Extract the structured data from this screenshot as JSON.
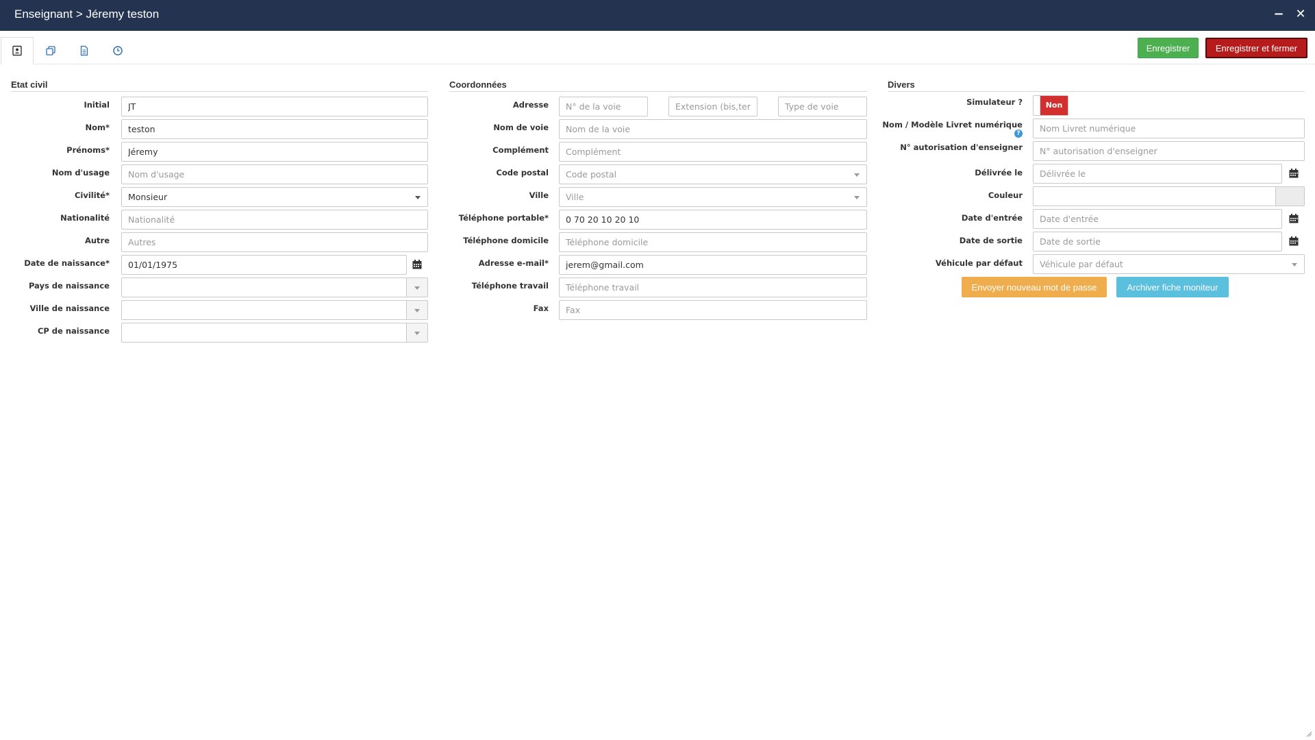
{
  "window": {
    "title": "Enseignant > Jéremy teston",
    "minimize_glyph": "−",
    "close_glyph": "✕"
  },
  "tabs": [
    {
      "icon": "contact-card-icon"
    },
    {
      "icon": "copy-icon"
    },
    {
      "icon": "document-icon"
    },
    {
      "icon": "clock-icon"
    }
  ],
  "toolbar": {
    "save_label": "Enregistrer",
    "save_close_label": "Enregistrer et fermer"
  },
  "etat_civil": {
    "title": "Etat civil",
    "initial": {
      "label": "Initial",
      "value": "JT",
      "placeholder": ""
    },
    "nom": {
      "label": "Nom*",
      "value": "teston",
      "placeholder": ""
    },
    "prenoms": {
      "label": "Prénoms*",
      "value": "Jéremy",
      "placeholder": ""
    },
    "nom_usage": {
      "label": "Nom d'usage",
      "value": "",
      "placeholder": "Nom d'usage"
    },
    "civilite": {
      "label": "Civilité*",
      "value": "Monsieur"
    },
    "nationalite": {
      "label": "Nationalité",
      "value": "",
      "placeholder": "Nationalité"
    },
    "autre": {
      "label": "Autre",
      "value": "",
      "placeholder": "Autres"
    },
    "date_naissance": {
      "label": "Date de naissance*",
      "value": "01/01/1975",
      "placeholder": ""
    },
    "pays_naissance": {
      "label": "Pays de naissance"
    },
    "ville_naissance": {
      "label": "Ville de naissance"
    },
    "cp_naissance": {
      "label": "CP de naissance"
    }
  },
  "coordonnees": {
    "title": "Coordonnées",
    "adresse": {
      "label": "Adresse",
      "num_placeholder": "N° de la voie",
      "ext_placeholder": "Extension (bis,ter.",
      "type_placeholder": "Type de voie"
    },
    "nom_voie": {
      "label": "Nom de voie",
      "value": "",
      "placeholder": "Nom de la voie"
    },
    "complement": {
      "label": "Complément",
      "value": "",
      "placeholder": "Complément"
    },
    "code_postal": {
      "label": "Code postal",
      "value": "Code postal"
    },
    "ville": {
      "label": "Ville",
      "value": "Ville"
    },
    "tel_portable": {
      "label": "Téléphone portable*",
      "value": "0 70 20 10 20 10",
      "placeholder": ""
    },
    "tel_domicile": {
      "label": "Téléphone domicile",
      "value": "",
      "placeholder": "Téléphone domicile"
    },
    "email": {
      "label": "Adresse e-mail*",
      "value": "jerem@gmail.com",
      "placeholder": ""
    },
    "tel_travail": {
      "label": "Téléphone travail",
      "value": "",
      "placeholder": "Téléphone travail"
    },
    "fax": {
      "label": "Fax",
      "value": "",
      "placeholder": "Fax"
    }
  },
  "divers": {
    "title": "Divers",
    "simulateur": {
      "label": "Simulateur ?",
      "state": "Non"
    },
    "livret": {
      "label": "Nom / Modèle Livret numérique",
      "value": "",
      "placeholder": "Nom Livret numérique",
      "help": "?"
    },
    "autorisation": {
      "label": "N° autorisation d'enseigner",
      "value": "",
      "placeholder": "N° autorisation d'enseigner"
    },
    "delivree": {
      "label": "Délivrée le",
      "value": "",
      "placeholder": "Délivrée le"
    },
    "couleur": {
      "label": "Couleur"
    },
    "date_entree": {
      "label": "Date d'entrée",
      "value": "",
      "placeholder": "Date d'entrée"
    },
    "date_sortie": {
      "label": "Date de sortie",
      "value": "",
      "placeholder": "Date de sortie"
    },
    "vehicule": {
      "label": "Véhicule par défaut",
      "value": "Véhicule par défaut"
    },
    "btn_password": "Envoyer nouveau mot de passe",
    "btn_archive": "Archiver fiche moniteur"
  }
}
